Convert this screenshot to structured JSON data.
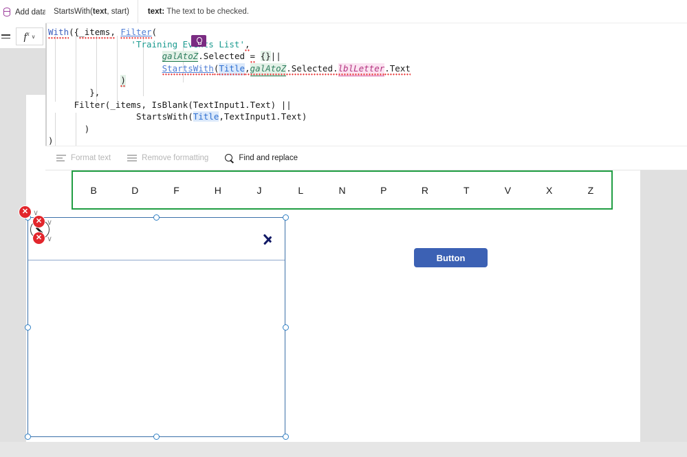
{
  "commandbar": {
    "add_data_label": "Add data",
    "add_data_caret": "∨",
    "add_data_icon": "database-icon"
  },
  "property_bar": {
    "menu_icon": "hamburger-icon",
    "fx_label": "fx",
    "fx_caret": "∨"
  },
  "formula_tooltip": {
    "signature_prefix": "StartsWith(",
    "signature_bold": "text",
    "signature_suffix": ", start)",
    "param_name": "text:",
    "param_description": "The text to be checked."
  },
  "formula": {
    "lines": [
      "With({_items, Filter(",
      "                'Training Events List',",
      "                      galAtoZ.Selected = {}||",
      "                      StartsWith(Title,galAtoZ.Selected.lblLetter.Text",
      "              )",
      "        },",
      "     Filter(_items, IsBlank(TextInput1.Text) ||",
      "                 StartsWith(Title,TextInput1.Text)",
      "       )",
      ")"
    ],
    "tokens": {
      "fn_with": "With",
      "fn_filter": "Filter",
      "fn_startswith": "StartsWith",
      "fn_isblank": "IsBlank",
      "var_items": "_items",
      "datasource": "'Training Events List'",
      "control_gallery": "galAtoZ",
      "control_label": "lblLetter",
      "control_textinput": "TextInput1",
      "column_title": "Title",
      "prop_selected": "Selected",
      "prop_text": "Text",
      "operator_or": "||",
      "operator_eq": "=",
      "empty_record": "{}"
    },
    "colors": {
      "function_blue": "#3c5fbf",
      "string_teal": "#1a9a8f",
      "control_green": "#2e7d5e",
      "control_pink": "#b3327f",
      "column_blue": "#2f6fd0",
      "error_squiggle": "#e83b3b"
    }
  },
  "formula_toolbar": {
    "items": [
      {
        "label": "Format text",
        "icon": "format-text-icon",
        "enabled": false
      },
      {
        "label": "Remove formatting",
        "icon": "remove-formatting-icon",
        "enabled": false
      },
      {
        "label": "Find and replace",
        "icon": "search-icon",
        "enabled": true
      }
    ]
  },
  "canvas": {
    "gallery": {
      "name": "galAtoZ",
      "border_color": "#1f9d42",
      "badge_icon": "lightbulb-icon",
      "items": [
        "B",
        "D",
        "F",
        "H",
        "J",
        "L",
        "N",
        "P",
        "R",
        "T",
        "V",
        "X",
        "Z"
      ]
    },
    "selected_container": {
      "border_color": "#3a6fa8",
      "chevron_icon": "chevron-right-icon",
      "edit_icon": "pencil-edit-icon"
    },
    "error_badges": [
      {
        "icon": "error-x-icon",
        "symbol": "✕"
      },
      {
        "icon": "error-x-icon",
        "symbol": "✕"
      },
      {
        "icon": "error-x-icon",
        "symbol": "✕"
      }
    ],
    "error_carets": [
      "∨",
      "∨",
      "∨"
    ],
    "button_control": {
      "label": "Button",
      "fill": "#3c61b4",
      "text_color": "#ffffff"
    }
  }
}
